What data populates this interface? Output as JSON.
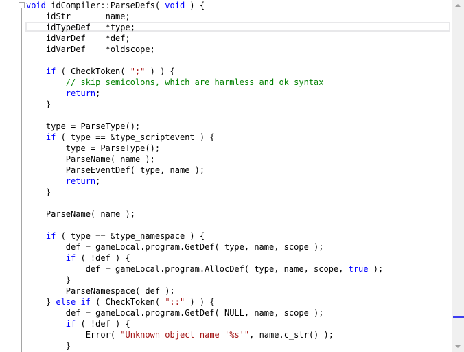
{
  "editor": {
    "lines": [
      [
        {
          "t": "void",
          "c": "kw"
        },
        {
          "t": " idCompiler::ParseDefs( "
        },
        {
          "t": "void",
          "c": "kw"
        },
        {
          "t": " ) {"
        }
      ],
      [
        {
          "t": "    idStr       name;"
        }
      ],
      [
        {
          "t": "    idTypeDef   *type;"
        }
      ],
      [
        {
          "t": "    idVarDef    *def;"
        }
      ],
      [
        {
          "t": "    idVarDef    *oldscope;"
        }
      ],
      [
        {
          "t": ""
        }
      ],
      [
        {
          "t": "    "
        },
        {
          "t": "if",
          "c": "kw"
        },
        {
          "t": " ( CheckToken( "
        },
        {
          "t": "\";\"",
          "c": "st"
        },
        {
          "t": " ) ) {"
        }
      ],
      [
        {
          "t": "        "
        },
        {
          "t": "// skip semicolons, which are harmless and ok syntax",
          "c": "cm"
        }
      ],
      [
        {
          "t": "        "
        },
        {
          "t": "return",
          "c": "kw"
        },
        {
          "t": ";"
        }
      ],
      [
        {
          "t": "    }"
        }
      ],
      [
        {
          "t": ""
        }
      ],
      [
        {
          "t": "    type = ParseType();"
        }
      ],
      [
        {
          "t": "    "
        },
        {
          "t": "if",
          "c": "kw"
        },
        {
          "t": " ( type == &type_scriptevent ) {"
        }
      ],
      [
        {
          "t": "        type = ParseType();"
        }
      ],
      [
        {
          "t": "        ParseName( name );"
        }
      ],
      [
        {
          "t": "        ParseEventDef( type, name );"
        }
      ],
      [
        {
          "t": "        "
        },
        {
          "t": "return",
          "c": "kw"
        },
        {
          "t": ";"
        }
      ],
      [
        {
          "t": "    }"
        }
      ],
      [
        {
          "t": ""
        }
      ],
      [
        {
          "t": "    ParseName( name );"
        }
      ],
      [
        {
          "t": ""
        }
      ],
      [
        {
          "t": "    "
        },
        {
          "t": "if",
          "c": "kw"
        },
        {
          "t": " ( type == &type_namespace ) {"
        }
      ],
      [
        {
          "t": "        def = gameLocal.program.GetDef( type, name, scope );"
        }
      ],
      [
        {
          "t": "        "
        },
        {
          "t": "if",
          "c": "kw"
        },
        {
          "t": " ( !def ) {"
        }
      ],
      [
        {
          "t": "            def = gameLocal.program.AllocDef( type, name, scope, "
        },
        {
          "t": "true",
          "c": "kw"
        },
        {
          "t": " );"
        }
      ],
      [
        {
          "t": "        }"
        }
      ],
      [
        {
          "t": "        ParseNamespace( def );"
        }
      ],
      [
        {
          "t": "    } "
        },
        {
          "t": "else",
          "c": "kw"
        },
        {
          "t": " "
        },
        {
          "t": "if",
          "c": "kw"
        },
        {
          "t": " ( CheckToken( "
        },
        {
          "t": "\"::\"",
          "c": "st"
        },
        {
          "t": " ) ) {"
        }
      ],
      [
        {
          "t": "        def = gameLocal.program.GetDef( NULL, name, scope );"
        }
      ],
      [
        {
          "t": "        "
        },
        {
          "t": "if",
          "c": "kw"
        },
        {
          "t": " ( !def ) {"
        }
      ],
      [
        {
          "t": "            Error( "
        },
        {
          "t": "\"Unknown object name '%s'\"",
          "c": "st"
        },
        {
          "t": ", name.c_str() );"
        }
      ],
      [
        {
          "t": "        }"
        }
      ]
    ]
  },
  "colors": {
    "keyword": "#0000ff",
    "comment": "#008000",
    "string": "#a31515",
    "text": "#000000"
  }
}
